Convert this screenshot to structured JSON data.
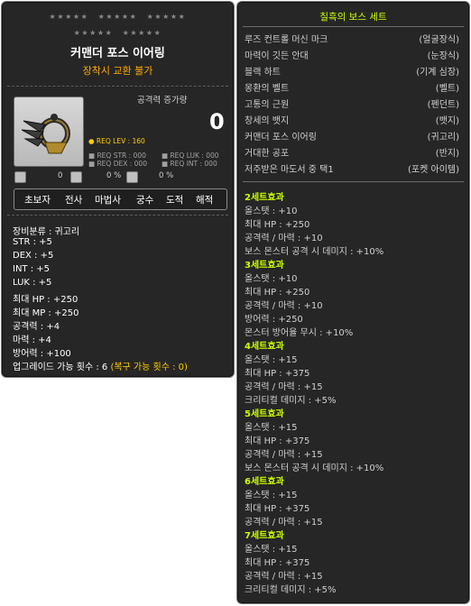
{
  "item": {
    "stars_row1": [
      "★★★★★",
      "★★★★★",
      "★★★★★"
    ],
    "stars_row2": [
      "★★★★★",
      "★★★★★"
    ],
    "name": "커맨더 포스 이어링",
    "trade": "장착시 교환 불가",
    "attack_increase_label": "공격력 증가량",
    "attack_increase_value": "0",
    "req_lev": "● REQ LEV : 160",
    "req_str": "■ REQ STR : 000",
    "req_luk": "■ REQ LUK : 000",
    "req_dex": "■ REQ DEX : 000",
    "req_int": "■ REQ INT : 000",
    "badges": [
      "0",
      "0 %",
      "0 %"
    ],
    "jobs": [
      "초보자",
      "전사",
      "마법사",
      "궁수",
      "도적",
      "해적"
    ],
    "stats": [
      "장비분류 : 귀고리",
      "STR : +5",
      "DEX : +5",
      "INT : +5",
      "LUK : +5",
      "최대 HP : +250",
      "최대 MP : +250",
      "공격력 : +4",
      "마력 : +4",
      "방어력 : +100"
    ],
    "upgrade_label": "업그레이드 가능 횟수 : 6",
    "upgrade_recover": "(복구 가능 횟수 : 0)"
  },
  "set": {
    "title": "칠흑의 보스 세트",
    "items": [
      {
        "name": "루즈 컨트롤 머신 마크",
        "type": "(얼굴장식)"
      },
      {
        "name": "마력이 깃든 안대",
        "type": "(눈장식)"
      },
      {
        "name": "블랙 하트",
        "type": "(기계 심장)"
      },
      {
        "name": "몽환의 벨트",
        "type": "(벨트)"
      },
      {
        "name": "고통의 근원",
        "type": "(펜던트)"
      },
      {
        "name": "창세의 뱃지",
        "type": "(뱃지)"
      },
      {
        "name": "커맨더 포스 이어링",
        "type": "(귀고리)"
      },
      {
        "name": "거대한 공포",
        "type": "(반지)"
      },
      {
        "name": "저주받은 마도서 중 택1",
        "type": "(포켓 아이템)"
      }
    ],
    "effects": [
      {
        "head": "2세트효과",
        "lines": [
          "올스탯 : +10",
          "최대 HP : +250",
          "공격력 / 마력 : +10",
          "보스 몬스터 공격 시 데미지 : +10%"
        ]
      },
      {
        "head": "3세트효과",
        "lines": [
          "올스탯 : +10",
          "최대 HP : +250",
          "공격력 / 마력 : +10",
          "방어력 : +250",
          "몬스터 방어율 무시 : +10%"
        ]
      },
      {
        "head": "4세트효과",
        "lines": [
          "올스탯 : +15",
          "최대 HP : +375",
          "공격력 / 마력 : +15",
          "크리티컬 데미지 : +5%"
        ]
      },
      {
        "head": "5세트효과",
        "lines": [
          "올스탯 : +15",
          "최대 HP : +375",
          "공격력 / 마력 : +15",
          "보스 몬스터 공격 시 데미지 : +10%"
        ]
      },
      {
        "head": "6세트효과",
        "lines": [
          "올스탯 : +15",
          "최대 HP : +375",
          "공격력 / 마력 : +15"
        ]
      },
      {
        "head": "7세트효과",
        "lines": [
          "올스탯 : +15",
          "최대 HP : +375",
          "공격력 / 마력 : +15",
          "크리티컬 데미지 : +5%"
        ]
      }
    ]
  },
  "colors": {
    "panel_bg": "#262626",
    "set_header": "#ccff00",
    "trade_warning": "#ffaa00",
    "recover_text": "#ffcc00"
  },
  "icons": [
    "earring-item-icon",
    "scissors-icon",
    "potential-icon",
    "slash-icon"
  ]
}
